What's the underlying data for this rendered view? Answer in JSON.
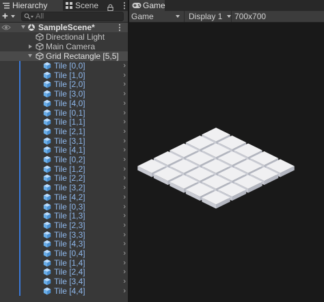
{
  "hierarchy": {
    "tab_label": "Hierarchy",
    "scene_tab_label": "Scene",
    "search_placeholder": "All",
    "add_label": "+",
    "scene_name": "SampleScene*",
    "objects": [
      {
        "label": "Directional Light"
      },
      {
        "label": "Main Camera"
      },
      {
        "label": "Grid Rectangle [5,5]"
      }
    ],
    "tiles": [
      "Tile [0,0]",
      "Tile [1,0]",
      "Tile [2,0]",
      "Tile [3,0]",
      "Tile [4,0]",
      "Tile [0,1]",
      "Tile [1,1]",
      "Tile [2,1]",
      "Tile [3,1]",
      "Tile [4,1]",
      "Tile [0,2]",
      "Tile [1,2]",
      "Tile [2,2]",
      "Tile [3,2]",
      "Tile [4,2]",
      "Tile [0,3]",
      "Tile [1,3]",
      "Tile [2,3]",
      "Tile [3,3]",
      "Tile [4,3]",
      "Tile [0,4]",
      "Tile [1,4]",
      "Tile [2,4]",
      "Tile [3,4]",
      "Tile [4,4]"
    ]
  },
  "game": {
    "tab_label": "Game",
    "view_mode": "Game",
    "display": "Display 1",
    "resolution": "700x700",
    "grid": {
      "cols": 5,
      "rows": 5
    }
  },
  "colors": {
    "panel_bg": "#383838",
    "viewport_bg": "#191919",
    "selection": "#4a4a4a",
    "tile_label": "#8fb8ec",
    "hierarchy_line": "#3a79d8",
    "tile_top": "#f0f0f2",
    "tile_side": "#c9cbd3"
  },
  "icons": [
    "hierarchy-icon",
    "scene-icon",
    "lock-icon",
    "kebab-icon",
    "search-icon",
    "eye-icon",
    "unity-scene-icon",
    "gameobject-icon",
    "cube-icon",
    "chevron-right-icon",
    "gamepad-icon"
  ]
}
